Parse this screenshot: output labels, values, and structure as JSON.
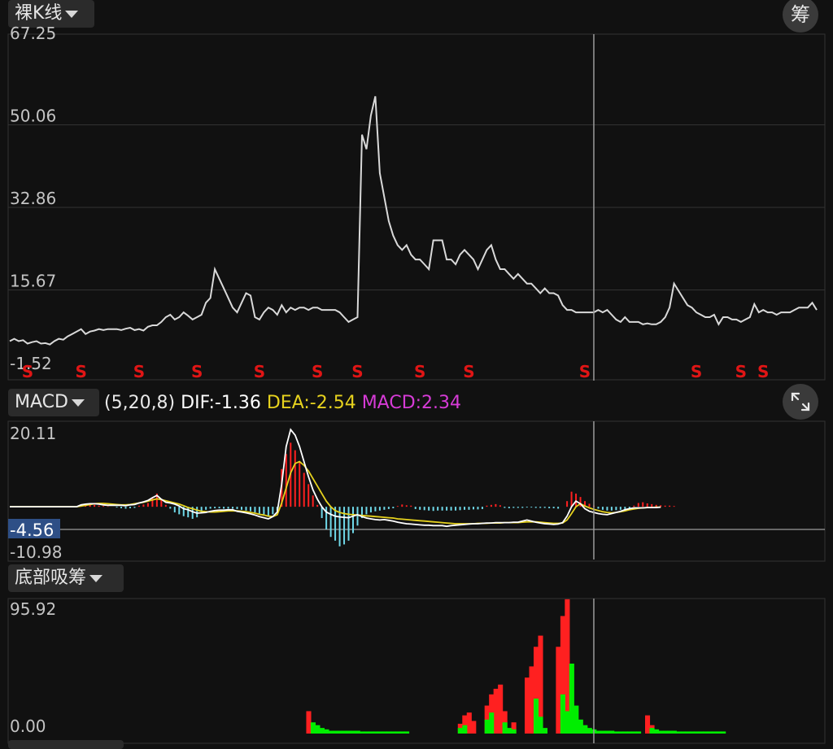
{
  "top_panel": {
    "indicator_label": "裸K线",
    "chip_button": "筹"
  },
  "macd_panel": {
    "indicator_label": "MACD",
    "params": "(5,20,8)",
    "dif_text": "DIF:-1.36",
    "dea_text": "DEA:-2.54",
    "macd_text": "MACD:2.34",
    "colors": {
      "params": "#e8e8e8",
      "dif": "#ffffff",
      "dea": "#e6d21e",
      "macd": "#d63bd6"
    }
  },
  "bottom_panel": {
    "indicator_label": "底部吸筹"
  },
  "colors": {
    "up": "#ff2020",
    "down": "#6fd8e8",
    "absorb": "#00ee00",
    "grid": "#333333",
    "crosshair": "#9a9a9a"
  },
  "chart_data": [
    {
      "type": "line",
      "name": "price",
      "ylim": [
        -1.52,
        67.25
      ],
      "y_ticks": [
        "67.25",
        "50.06",
        "32.86",
        "15.67",
        "-1.52"
      ],
      "values": [
        5,
        5.5,
        5,
        5.2,
        4.5,
        4.8,
        5,
        4.5,
        4.6,
        4.3,
        5,
        5.5,
        5.3,
        6,
        6.5,
        7,
        7.5,
        6.5,
        7,
        7.2,
        7.5,
        7.3,
        7.5,
        7.5,
        7.5,
        7.3,
        7.6,
        7.8,
        7.3,
        7.5,
        7.2,
        8,
        8.3,
        8.3,
        9,
        10,
        10.5,
        9.5,
        10,
        11,
        10.3,
        9.5,
        10,
        10.5,
        13,
        14,
        20,
        18,
        16,
        14,
        12,
        11,
        13,
        15,
        14.5,
        10,
        9.5,
        11,
        12,
        11.5,
        10.5,
        12.5,
        11,
        12,
        11.5,
        12,
        12,
        11.5,
        12,
        12,
        11.5,
        11.5,
        11.5,
        11.5,
        11,
        10,
        9,
        9.5,
        10,
        48,
        45,
        52,
        56,
        40,
        35,
        30,
        27,
        25,
        24,
        25,
        23,
        22,
        22,
        21,
        20,
        26,
        26,
        26,
        22,
        22,
        21,
        23,
        24,
        23,
        22,
        20,
        22,
        24,
        25,
        22,
        20,
        20,
        19,
        18,
        19,
        18,
        17,
        17,
        16,
        15,
        16,
        15,
        15,
        14.5,
        12.5,
        11.5,
        11.5,
        11,
        11,
        11,
        11,
        11,
        11.5,
        11,
        11.5,
        10.5,
        9.5,
        9,
        10,
        9,
        9,
        9,
        8.5,
        8.7,
        8.5,
        8.5,
        9,
        10,
        12,
        17,
        15.5,
        14,
        12.5,
        12,
        11,
        10.5,
        10,
        10,
        10.5,
        8.5,
        10,
        10,
        9.5,
        9.5,
        9,
        9.5,
        10,
        12.7,
        11,
        11.5,
        11,
        11,
        10.5,
        11,
        11,
        11,
        11.5,
        12,
        12,
        12,
        13,
        11.5
      ],
      "s_markers": [
        4,
        16,
        29,
        42,
        56,
        69,
        78,
        92,
        103,
        129,
        154,
        164,
        169
      ],
      "s_label": "S"
    },
    {
      "type": "bar",
      "name": "MACD",
      "ylim": [
        -10.98,
        20.11
      ],
      "y_ticks": [
        "20.11",
        "-10.98"
      ],
      "current_value_label": "-4.56",
      "dif": [
        0,
        0,
        0,
        0,
        0,
        0,
        0,
        0,
        0,
        0,
        0,
        0,
        0,
        0,
        0,
        0,
        0.5,
        0.7,
        0.8,
        0.8,
        0.7,
        0.5,
        0.4,
        0.4,
        0.4,
        0.4,
        0.3,
        0.5,
        0.6,
        1.0,
        1.3,
        1.7,
        2.4,
        3.0,
        2.0,
        1.2,
        1.0,
        0.7,
        0.2,
        -0.5,
        -0.8,
        -1.3,
        -1.7,
        -1.6,
        -1.5,
        -1.2,
        -1.0,
        -0.9,
        -0.9,
        -0.8,
        -0.8,
        -1.2,
        -1.4,
        -1.6,
        -1.9,
        -2.2,
        -2.6,
        -2.9,
        -3.2,
        -2.6,
        -1.4,
        6,
        16,
        20.5,
        19,
        16,
        12,
        8,
        4.5,
        2,
        0,
        -1.4,
        -2.0,
        -2.5,
        -2.7,
        -2.8,
        -2.9,
        -2.5,
        -2.1,
        -2.6,
        -3.0,
        -3.2,
        -3.4,
        -3.5,
        -3.4,
        -3.6,
        -3.8,
        -4.1,
        -4.3,
        -4.5,
        -4.6,
        -4.7,
        -4.8,
        -4.9,
        -4.9,
        -5.0,
        -5.0,
        -5.0,
        -5.2,
        -5.0,
        -4.9,
        -4.8,
        -4.7,
        -4.6,
        -4.5,
        -4.5,
        -4.4,
        -4.3,
        -4.3,
        -4.2,
        -4.2,
        -4.2,
        -4.2,
        -4.1,
        -4.1,
        -3.8,
        -3.5,
        -3.8,
        -4.1,
        -4.3,
        -4.5,
        -4.6,
        -4.7,
        -4.6,
        -4.2,
        -2.5,
        0,
        1.5,
        0.8,
        -0.5,
        -1.2,
        -1.5,
        -1.8,
        -2.0,
        -2.1,
        -1.8,
        -1.5,
        -1.2,
        -0.8,
        -0.5,
        -0.3,
        -0.3,
        -0.3,
        -0.2,
        -0.2,
        -0.2,
        -0.1
      ],
      "dea": [
        0,
        0,
        0,
        0,
        0,
        0,
        0,
        0,
        0,
        0,
        0,
        0,
        0,
        0,
        0,
        0,
        0.2,
        0.4,
        0.6,
        0.8,
        0.9,
        0.9,
        0.8,
        0.7,
        0.6,
        0.5,
        0.5,
        0.6,
        0.8,
        1.0,
        1.2,
        1.5,
        1.8,
        2.1,
        1.9,
        1.6,
        1.3,
        1.0,
        0.7,
        0.3,
        -0.2,
        -0.5,
        -0.9,
        -1.2,
        -1.3,
        -1.4,
        -1.4,
        -1.3,
        -1.2,
        -1.1,
        -1.1,
        -1.1,
        -1.2,
        -1.3,
        -1.5,
        -1.7,
        -2.0,
        -2.2,
        -2.5,
        -2.6,
        -2.1,
        1,
        5,
        9,
        11.5,
        12,
        11,
        9.5,
        7.5,
        5.5,
        3.5,
        1.5,
        0,
        -1,
        -1.5,
        -1.8,
        -2.0,
        -2.1,
        -2.2,
        -2.3,
        -2.4,
        -2.5,
        -2.6,
        -2.7,
        -2.8,
        -2.9,
        -3.0,
        -3.2,
        -3.3,
        -3.4,
        -3.5,
        -3.6,
        -3.7,
        -3.8,
        -3.9,
        -4.0,
        -4.1,
        -4.2,
        -4.3,
        -4.4,
        -4.5,
        -4.5,
        -4.5,
        -4.5,
        -4.5,
        -4.4,
        -4.4,
        -4.4,
        -4.3,
        -4.3,
        -4.3,
        -4.2,
        -4.2,
        -4.2,
        -4.2,
        -4.1,
        -4.0,
        -4.0,
        -4.0,
        -4.1,
        -4.2,
        -4.3,
        -4.4,
        -4.4,
        -4.3,
        -3.5,
        -1.8,
        0,
        0.8,
        0.2,
        -0.3,
        -0.7,
        -1.0,
        -1.3,
        -1.5,
        -1.6,
        -1.5,
        -1.3,
        -1.1,
        -0.8,
        -0.6,
        -0.4,
        -0.3,
        -0.2,
        -0.2,
        -0.1,
        -0.1
      ],
      "histogram": [
        0,
        0,
        0,
        0,
        0,
        0,
        0,
        0,
        0,
        0,
        0,
        0,
        0,
        0,
        0,
        0,
        0.4,
        0.5,
        0.6,
        0.5,
        0.3,
        0.2,
        0.1,
        0,
        -0.2,
        -0.4,
        -0.5,
        -0.4,
        -0.3,
        0.3,
        0.6,
        1.0,
        2.5,
        3.5,
        2.0,
        0.5,
        -0.5,
        -1.5,
        -2.0,
        -2.5,
        -2.8,
        -3.2,
        -2.8,
        -1.5,
        -0.8,
        -0.5,
        -0.4,
        -0.4,
        -0.5,
        -0.5,
        -0.5,
        -0.6,
        -0.8,
        -1.0,
        -1.2,
        -1.5,
        -1.8,
        -2.0,
        -2.5,
        -2.0,
        -1.0,
        10,
        14,
        17,
        15,
        12,
        9,
        6,
        3,
        0.5,
        -3,
        -6,
        -8,
        -9,
        -10.5,
        -10,
        -9,
        -7,
        -5,
        -3,
        -2,
        -1.5,
        -1.2,
        -1,
        -0.8,
        -0.6,
        -0.4,
        0.2,
        0.6,
        0.4,
        0.3,
        -0.6,
        -0.8,
        -0.9,
        -1.0,
        -1.1,
        -1.0,
        -1.0,
        -1.0,
        -1.0,
        -1.0,
        -0.9,
        -0.8,
        -0.8,
        -0.7,
        -0.7,
        -0.6,
        0.3,
        0.5,
        0.7,
        0.4,
        -0.3,
        -0.4,
        -0.3,
        -0.3,
        -0.3,
        -0.2,
        -0.2,
        -0.3,
        -0.3,
        -0.3,
        -0.4,
        -0.4,
        -0.5,
        0,
        1.5,
        4,
        3.5,
        2.6,
        1.5,
        0.8,
        0.3,
        -0.5,
        -0.8,
        -1.0,
        -1.0,
        -0.9,
        -0.8,
        -0.6,
        -0.4,
        0.3,
        1.0,
        1.2,
        0.9,
        0.7,
        0.5,
        0.4,
        0.3,
        0.3,
        0.2
      ]
    },
    {
      "type": "bar",
      "name": "底部吸筹",
      "ylim": [
        0,
        95.92
      ],
      "y_ticks": [
        "95.92",
        "0.00"
      ],
      "red_bars": [
        [
          67,
          16
        ],
        [
          68,
          5
        ],
        [
          101,
          7
        ],
        [
          102,
          13
        ],
        [
          103,
          15
        ],
        [
          104,
          9
        ],
        [
          107,
          20
        ],
        [
          108,
          28
        ],
        [
          109,
          32
        ],
        [
          110,
          35
        ],
        [
          111,
          16
        ],
        [
          113,
          8
        ],
        [
          116,
          40
        ],
        [
          117,
          48
        ],
        [
          118,
          62
        ],
        [
          119,
          70
        ],
        [
          123,
          62
        ],
        [
          124,
          84
        ],
        [
          125,
          96
        ],
        [
          127,
          6
        ],
        [
          143,
          13
        ],
        [
          144,
          6
        ]
      ],
      "green_bars": [
        [
          68,
          8
        ],
        [
          69,
          6
        ],
        [
          70,
          4
        ],
        [
          71,
          3
        ],
        [
          72,
          2
        ],
        [
          73,
          2
        ],
        [
          74,
          2
        ],
        [
          75,
          2
        ],
        [
          76,
          2
        ],
        [
          77,
          2
        ],
        [
          78,
          2
        ],
        [
          79,
          1.5
        ],
        [
          80,
          1.5
        ],
        [
          81,
          1.5
        ],
        [
          82,
          1.5
        ],
        [
          83,
          1.5
        ],
        [
          84,
          1.5
        ],
        [
          85,
          1.5
        ],
        [
          86,
          1.5
        ],
        [
          87,
          1.5
        ],
        [
          88,
          1.5
        ],
        [
          89,
          1.5
        ],
        [
          101,
          4
        ],
        [
          102,
          6
        ],
        [
          107,
          10
        ],
        [
          108,
          15
        ],
        [
          111,
          8
        ],
        [
          112,
          4
        ],
        [
          113,
          3
        ],
        [
          118,
          25
        ],
        [
          119,
          12
        ],
        [
          120,
          4
        ],
        [
          124,
          28
        ],
        [
          125,
          16
        ],
        [
          126,
          50
        ],
        [
          127,
          20
        ],
        [
          128,
          10
        ],
        [
          129,
          6
        ],
        [
          130,
          4
        ],
        [
          131,
          3
        ],
        [
          132,
          2
        ],
        [
          133,
          2
        ],
        [
          134,
          2
        ],
        [
          135,
          2
        ],
        [
          136,
          1.5
        ],
        [
          137,
          1.5
        ],
        [
          138,
          1.5
        ],
        [
          139,
          1.5
        ],
        [
          140,
          1.5
        ],
        [
          141,
          1.5
        ],
        [
          144,
          4
        ],
        [
          145,
          3
        ],
        [
          146,
          2
        ],
        [
          147,
          2
        ],
        [
          148,
          2
        ],
        [
          149,
          2
        ],
        [
          150,
          1.5
        ],
        [
          151,
          1.5
        ],
        [
          152,
          1.5
        ],
        [
          153,
          1.5
        ],
        [
          154,
          1.5
        ],
        [
          155,
          1.5
        ],
        [
          156,
          1.5
        ],
        [
          157,
          1.5
        ],
        [
          158,
          1.5
        ],
        [
          159,
          1.5
        ],
        [
          160,
          1.5
        ]
      ]
    }
  ]
}
